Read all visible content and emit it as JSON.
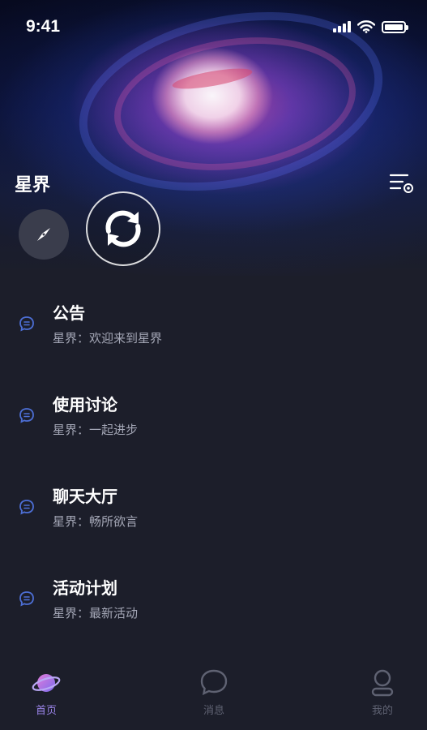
{
  "status_bar": {
    "time": "9:41"
  },
  "app": {
    "title": "星界"
  },
  "channels": [
    {
      "title": "公告",
      "subtitle": "星界：欢迎来到星界"
    },
    {
      "title": "使用讨论",
      "subtitle": "星界：一起进步"
    },
    {
      "title": "聊天大厅",
      "subtitle": "星界：畅所欲言"
    },
    {
      "title": "活动计划",
      "subtitle": "星界：最新活动"
    }
  ],
  "tab_bar": {
    "items": [
      {
        "label": "首页",
        "icon": "planet-icon",
        "active": true
      },
      {
        "label": "消息",
        "icon": "chat-bubble-icon",
        "active": false
      },
      {
        "label": "我的",
        "icon": "person-icon",
        "active": false
      }
    ]
  },
  "colors": {
    "background": "#1c1e2a",
    "accent_active_tab": "#9a84e8",
    "inactive_tab": "#5f6272",
    "subtitle_text": "#a4a7b6",
    "channel_icon": "#4d6fd6"
  }
}
